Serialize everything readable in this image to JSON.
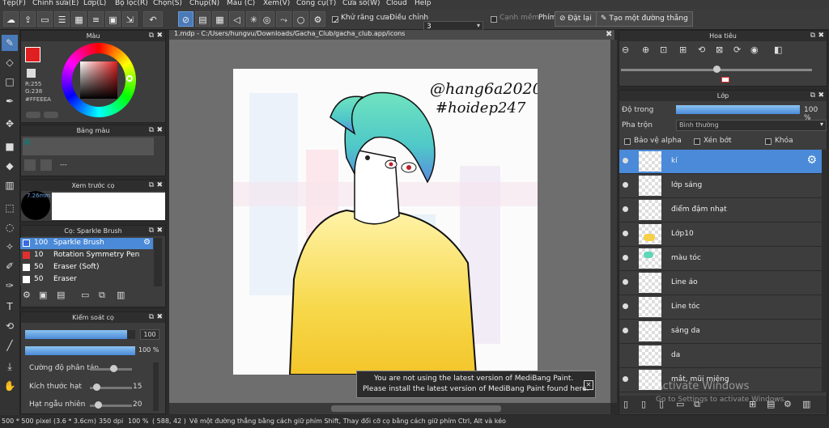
{
  "menu": [
    "Tệp(F)",
    "Chỉnh sửa(E)",
    "Lớp(L)",
    "Bộ lọc(R)",
    "Chọn(S)",
    "Chụp(N)",
    "Màu (C)",
    "Xem(V)",
    "Công cụ(T)",
    "Cửa sổ(W)",
    "Cloud",
    "Help"
  ],
  "toolbar": {
    "antialias_label": "Khử răng cưa",
    "adjust_label": "Điều chỉnh",
    "adjust_value": "3",
    "edge_label": "Cạnh mềm",
    "key_label": "Phím",
    "reset_label": "Đặt lại",
    "make_line_label": "Tạo một đường thẳng"
  },
  "color_panel": {
    "title": "Màu",
    "r": "R:255",
    "g": "G:238",
    "hex": "#FFEEEA"
  },
  "palette_panel": {
    "title": "Bảng màu",
    "dash": "---"
  },
  "preview_panel": {
    "title": "Xem trước cọ",
    "size": "7.26mm"
  },
  "brush_panel": {
    "title": "Cọ: Sparkle Brush",
    "brushes": [
      {
        "size": "100",
        "name": "Sparkle Brush",
        "color": "#3a6ae0"
      },
      {
        "size": "10",
        "name": "Rotation Symmetry Pen",
        "color": "#e03030"
      },
      {
        "size": "50",
        "name": "Eraser (Soft)",
        "color": "#ffffff"
      },
      {
        "size": "50",
        "name": "Eraser",
        "color": "#ffffff"
      }
    ]
  },
  "brush_control": {
    "title": "Kiểm soát cọ",
    "size_value": "100",
    "opacity_value": "100 %",
    "size_fill": 0.93,
    "opacity_fill": 1.0,
    "sliders": [
      {
        "label": "Cường độ phân tán",
        "value": "",
        "fill": 0.55
      },
      {
        "label": "Kích thước hạt",
        "value": "15",
        "fill": 0.15
      },
      {
        "label": "Hạt ngẫu nhiên",
        "value": "20",
        "fill": 0.2
      }
    ]
  },
  "document": {
    "tab": "1.mdp - C:/Users/hungvu/Downloads/Gacha_Club/gacha_club.app/icons",
    "signature_line1": "@hang6a2020",
    "signature_line2": "#hoidep247"
  },
  "navigator": {
    "title": "Hoa tiêu"
  },
  "layer_panel": {
    "title": "Lớp",
    "opacity_label": "Độ trong",
    "opacity_value": "100 %",
    "opacity_fill": 1.0,
    "blend_label": "Pha trộn",
    "blend_value": "Bình thường",
    "protect_alpha": "Bảo vệ alpha",
    "clip": "Xén bớt",
    "lock": "Khóa",
    "layers": [
      "kí",
      "lớp sáng",
      "điểm đậm nhạt",
      "Lớp10",
      "màu tóc",
      "Line áo",
      "Line tóc",
      "sáng da",
      "da",
      "mắt, mũi miệng"
    ]
  },
  "notice": {
    "line1": "You are not using the latest version of MediBang Paint.",
    "line2": "Please install the latest version of MediBang Paint found here."
  },
  "watermark": {
    "line1": "Activate Windows",
    "line2": "Go to Settings to activate Windows."
  },
  "status": {
    "size": "500 * 500 pixel",
    "cm": "(3.6 * 3.6cm)",
    "dpi": "350 dpi",
    "zoom": "100 %",
    "coords": "( 588, 42 )",
    "hint": "Vẽ một đường thẳng bằng cách giữ phím Shift, Thay đổi cỡ cọ bằng cách giữ phím Ctrl, Alt và kéo"
  },
  "colors": {
    "accent": "#4a8ad8",
    "panel": "#3d3d3d",
    "hair": "#5fd6b6",
    "shirt": "#f5d048"
  }
}
